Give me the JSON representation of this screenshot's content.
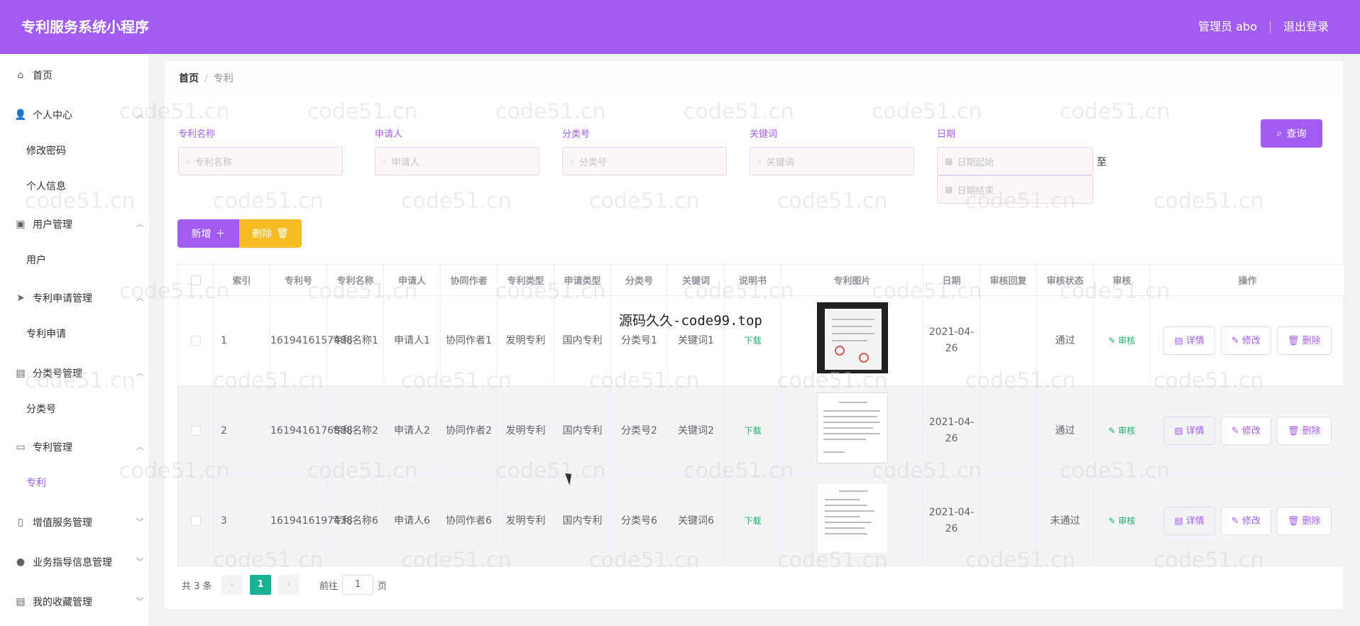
{
  "header": {
    "title": "专利服务系统小程序",
    "user": "管理员 abo",
    "logout": "退出登录"
  },
  "sidebar": {
    "home": "首页",
    "personal": "个人中心",
    "change_password": "修改密码",
    "personal_info": "个人信息",
    "user_mgmt": "用户管理",
    "user": "用户",
    "patent_apply_mgmt": "专利申请管理",
    "patent_apply": "专利申请",
    "category_mgmt": "分类号管理",
    "category": "分类号",
    "patent_mgmt": "专利管理",
    "patent": "专利",
    "value_added": "增值服务管理",
    "guidance": "业务指导信息管理",
    "favorites": "我的收藏管理"
  },
  "breadcrumb": {
    "home": "首页",
    "current": "专利"
  },
  "filters": {
    "name_label": "专利名称",
    "name_placeholder": "专利名称",
    "applicant_label": "申请人",
    "applicant_placeholder": "申请人",
    "category_label": "分类号",
    "category_placeholder": "分类号",
    "keyword_label": "关键词",
    "keyword_placeholder": "关键词",
    "date_label": "日期",
    "date_start": "日期起始",
    "date_end": "日期结束",
    "to": "至",
    "query": "查询"
  },
  "actions": {
    "add": "新增",
    "delete": "删除"
  },
  "table": {
    "headers": [
      "索引",
      "专利号",
      "专利名称",
      "申请人",
      "协同作者",
      "专利类型",
      "申请类型",
      "分类号",
      "关键词",
      "说明书",
      "专利图片",
      "日期",
      "审核回复",
      "审核状态",
      "审核",
      "操作"
    ],
    "rows": [
      {
        "index": "1",
        "patent_no": "1619416157488",
        "name": "专利名称1",
        "applicant": "申请人1",
        "coauthor": "协同作者1",
        "patent_type": "发明专利",
        "apply_type": "国内专利",
        "category": "分类号1",
        "keyword": "关键词1",
        "manual": "下载",
        "date": "2021-04-26",
        "reply": "",
        "status": "通过",
        "audit": "审核"
      },
      {
        "index": "2",
        "patent_no": "1619416176888",
        "name": "专利名称2",
        "applicant": "申请人2",
        "coauthor": "协同作者2",
        "patent_type": "发明专利",
        "apply_type": "国内专利",
        "category": "分类号2",
        "keyword": "关键词2",
        "manual": "下载",
        "date": "2021-04-26",
        "reply": "",
        "status": "通过",
        "audit": "审核"
      },
      {
        "index": "3",
        "patent_no": "1619416197438",
        "name": "专利名称6",
        "applicant": "申请人6",
        "coauthor": "协同作者6",
        "patent_type": "发明专利",
        "apply_type": "国内专利",
        "category": "分类号6",
        "keyword": "关键词6",
        "manual": "下载",
        "date": "2021-04-26",
        "reply": "",
        "status": "未通过",
        "audit": "审核"
      }
    ],
    "op_detail": "详情",
    "op_edit": "修改",
    "op_delete": "删除"
  },
  "pagination": {
    "total": "共 3 条",
    "page": "1",
    "goto_prefix": "前往",
    "goto_value": "1",
    "goto_suffix": "页"
  },
  "overlay": "源码久久-code99.top",
  "watermark": "code51.cn",
  "colors": {
    "accent": "#a35cf0",
    "warning": "#f5bd23",
    "success": "#20b16a",
    "page_active": "#19b394"
  }
}
